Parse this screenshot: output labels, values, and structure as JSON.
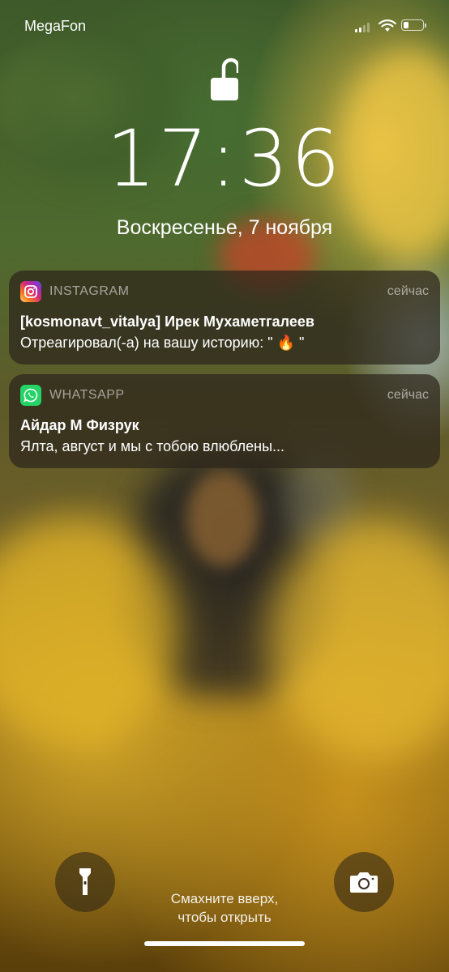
{
  "status_bar": {
    "carrier": "MegaFon",
    "signal_bars_active": 2,
    "signal_bars_total": 4,
    "battery_level": 0.3
  },
  "lock_screen": {
    "time": "17:36",
    "date": "Воскресенье, 7 ноября"
  },
  "notifications": [
    {
      "app": "INSTAGRAM",
      "time": "сейчас",
      "title": "[kosmonavt_vitalya] Ирек Мухаметгалеев",
      "body": "Отреагировал(-а) на вашу историю: \" 🔥 \"",
      "icon": "instagram-icon"
    },
    {
      "app": "WHATSAPP",
      "time": "сейчас",
      "title": "Айдар М Физрук",
      "body": "Ялта, август и мы с тобою влюблены...",
      "icon": "whatsapp-icon"
    }
  ],
  "bottom": {
    "hint_line1": "Смахните вверх,",
    "hint_line2": "чтобы открыть",
    "flashlight_icon": "flashlight-icon",
    "camera_icon": "camera-icon"
  },
  "colors": {
    "instagram_gradient": [
      "#feda75",
      "#fa7e1e",
      "#d62976",
      "#962fbf",
      "#4f5bd5"
    ],
    "whatsapp_green": "#25D366",
    "notification_bg": "rgba(45,38,28,0.72)"
  }
}
